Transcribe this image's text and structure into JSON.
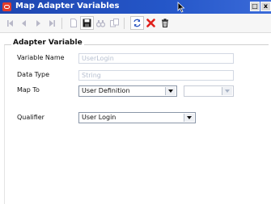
{
  "window": {
    "title": "Map Adapter Variables"
  },
  "toolbar": {
    "buttons": [
      {
        "name": "first-record",
        "icon": "first-icon",
        "enabled": false
      },
      {
        "name": "previous-record",
        "icon": "previous-icon",
        "enabled": false
      },
      {
        "name": "next-record",
        "icon": "next-icon",
        "enabled": false
      },
      {
        "name": "last-record",
        "icon": "last-icon",
        "enabled": false
      },
      {
        "name": "new-record",
        "icon": "new-document-icon",
        "enabled": false
      },
      {
        "name": "save",
        "icon": "save-icon",
        "enabled": true
      },
      {
        "name": "find",
        "icon": "binoculars-icon",
        "enabled": false
      },
      {
        "name": "copy",
        "icon": "copy-icon",
        "enabled": false
      },
      {
        "name": "refresh",
        "icon": "refresh-icon",
        "enabled": true
      },
      {
        "name": "cancel",
        "icon": "red-x-icon",
        "enabled": true
      },
      {
        "name": "delete",
        "icon": "trash-icon",
        "enabled": true
      }
    ]
  },
  "form": {
    "group_title": "Adapter Variable",
    "variable_name": {
      "label": "Variable Name",
      "value": "UserLogin"
    },
    "data_type": {
      "label": "Data Type",
      "value": "String"
    },
    "map_to": {
      "label": "Map To",
      "value": "User Definition",
      "secondary_value": ""
    },
    "qualifier": {
      "label": "Qualifier",
      "value": "User Login"
    }
  },
  "colors": {
    "titlebar": "#2456c8",
    "cancel_red": "#e0201a",
    "disabled_text": "#b6bfd0"
  }
}
